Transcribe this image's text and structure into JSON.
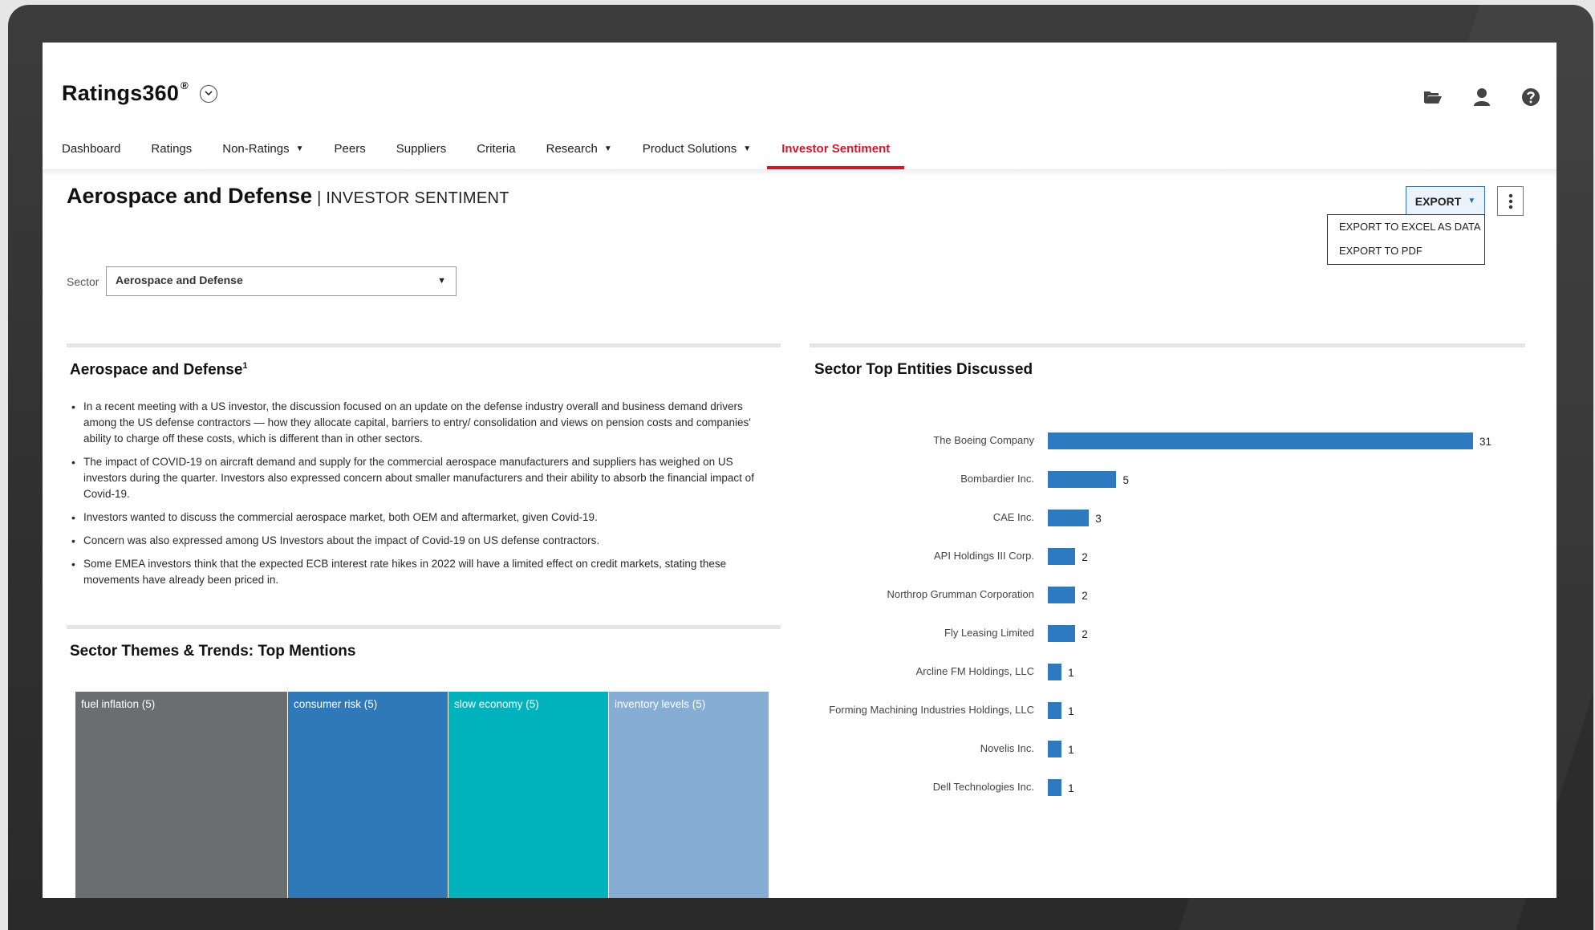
{
  "app": {
    "logo": "Ratings360",
    "logo_mark": "®"
  },
  "nav": [
    {
      "label": "Dashboard",
      "dropdown": false,
      "active": false
    },
    {
      "label": "Ratings",
      "dropdown": false,
      "active": false
    },
    {
      "label": "Non-Ratings",
      "dropdown": true,
      "active": false
    },
    {
      "label": "Peers",
      "dropdown": false,
      "active": false
    },
    {
      "label": "Suppliers",
      "dropdown": false,
      "active": false
    },
    {
      "label": "Criteria",
      "dropdown": false,
      "active": false
    },
    {
      "label": "Research",
      "dropdown": true,
      "active": false
    },
    {
      "label": "Product Solutions",
      "dropdown": true,
      "active": false
    },
    {
      "label": "Investor Sentiment",
      "dropdown": false,
      "active": true
    }
  ],
  "page": {
    "title": "Aerospace and Defense",
    "separator": "|",
    "subtitle": "INVESTOR SENTIMENT"
  },
  "export": {
    "label": "EXPORT",
    "menu": [
      "EXPORT TO EXCEL AS DATA",
      "EXPORT TO PDF"
    ]
  },
  "filter": {
    "label": "Sector",
    "value": "Aerospace and Defense"
  },
  "summary": {
    "title": "Aerospace and Defense",
    "footnote": "1",
    "bullets": [
      "In a recent meeting with a US investor, the discussion focused on an update on the defense industry overall and business demand drivers among the US defense contractors — how they allocate capital, barriers to entry/ consolidation and views on pension costs and companies' ability to charge off these costs, which is different than in other sectors.",
      "The impact of COVID-19 on aircraft demand and supply for the commercial aerospace manufacturers and suppliers has weighed on US investors during the quarter. Investors also expressed concern about smaller manufacturers and their ability to absorb the financial impact of Covid-19.",
      "Investors wanted to discuss the commercial aerospace market, both OEM and aftermarket, given Covid-19.",
      "Concern was also expressed among US Investors about the impact of Covid-19 on US defense contractors.",
      "Some EMEA investors think that the expected ECB interest rate hikes in 2022 will have a limited effect on credit markets, stating these movements have already been priced in."
    ]
  },
  "themes": {
    "title": "Sector Themes & Trends: Top Mentions",
    "tiles": [
      {
        "label": "fuel inflation (5)",
        "color": "#6b6e6e",
        "share": 0.3064
      },
      {
        "label": "consumer risk (5)",
        "color": "#2f79b8",
        "share": 0.2312
      },
      {
        "label": "slow economy (5)",
        "color": "#00b2bb",
        "share": 0.2312
      },
      {
        "label": "inventory levels (5)",
        "color": "#86aed4",
        "share": 0.2312
      }
    ]
  },
  "chart_data": {
    "type": "bar",
    "orientation": "horizontal",
    "title": "Sector Top Entities Discussed",
    "categories": [
      "The Boeing Company",
      "Bombardier Inc.",
      "CAE Inc.",
      "API Holdings III Corp.",
      "Northrop Grumman Corporation",
      "Fly Leasing Limited",
      "Arcline FM Holdings, LLC",
      "Forming Machining Industries Holdings, LLC",
      "Novelis Inc.",
      "Dell Technologies Inc."
    ],
    "values": [
      31,
      5,
      3,
      2,
      2,
      2,
      1,
      1,
      1,
      1
    ],
    "data_labels": [
      "31",
      "5",
      "3",
      "2",
      "2",
      "2",
      "1",
      "1",
      "1",
      "1"
    ],
    "color": "#2f79c0",
    "grid": false,
    "legend": "none"
  }
}
